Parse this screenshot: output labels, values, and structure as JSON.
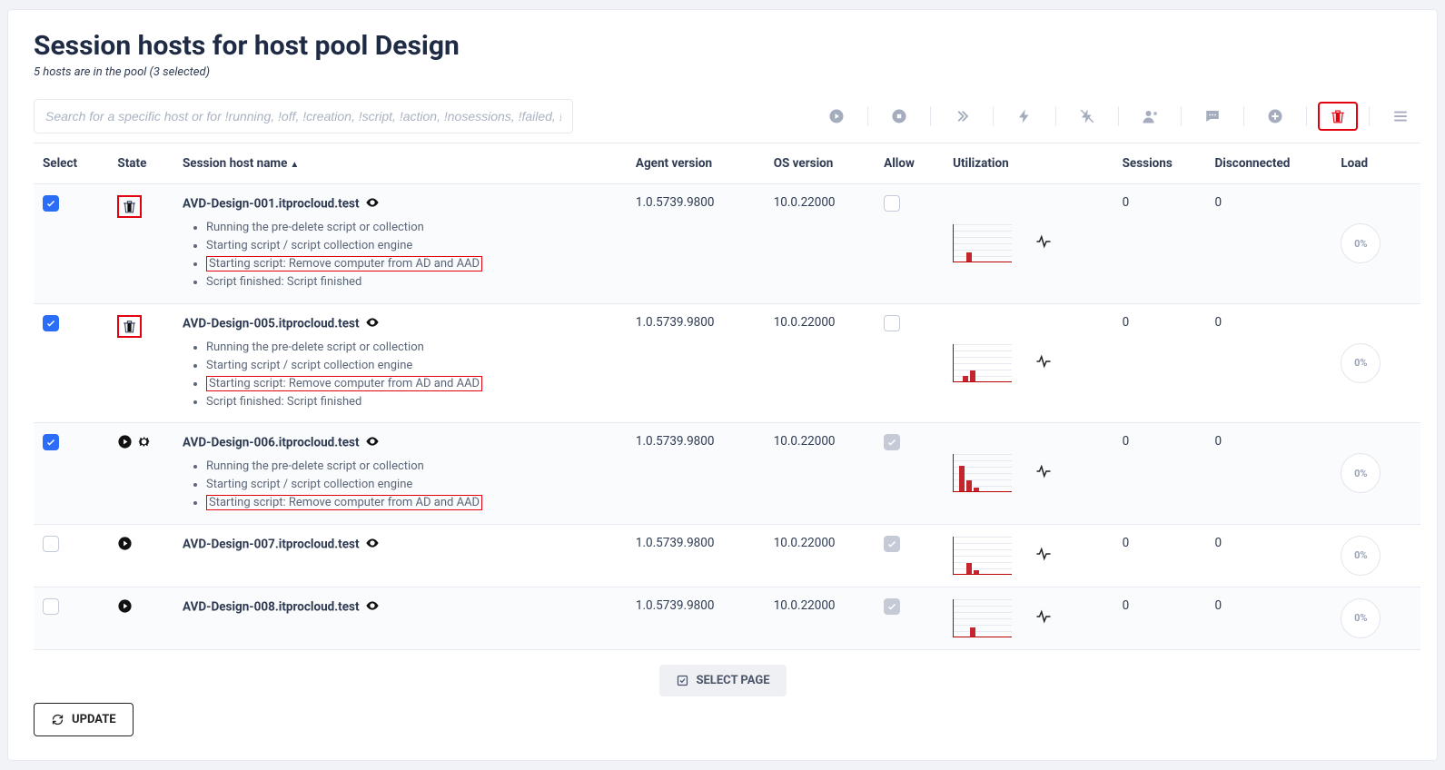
{
  "header": {
    "title": "Session hosts for host pool Design",
    "subtitle": "5 hosts are in the pool (3 selected)"
  },
  "search": {
    "placeholder": "Search for a specific host or for !running, !off, !creation, !script, !action, !nosessions, !failed, !drain"
  },
  "actions": [
    {
      "name": "start-icon"
    },
    {
      "name": "stop-icon"
    },
    {
      "name": "restart-icon"
    },
    {
      "name": "power-icon"
    },
    {
      "name": "drain-off-icon"
    },
    {
      "name": "user-icon"
    },
    {
      "name": "message-icon"
    },
    {
      "name": "add-icon"
    },
    {
      "name": "delete-icon",
      "highlight": true
    },
    {
      "name": "menu-icon"
    }
  ],
  "columns": {
    "select": "Select",
    "state": "State",
    "hostname": "Session host name",
    "agent": "Agent version",
    "os": "OS version",
    "allow": "Allow",
    "util": "Utilization",
    "sessions": "Sessions",
    "disconnected": "Disconnected",
    "load": "Load"
  },
  "rows": [
    {
      "selected": true,
      "state": {
        "kind": "delete-box"
      },
      "host": "AVD-Design-001.itprocloud.test",
      "notes": [
        {
          "text": "Running the pre-delete script or collection",
          "hl": false
        },
        {
          "text": "Starting script / script collection engine",
          "hl": false
        },
        {
          "text": "Starting script: Remove computer from AD and AAD",
          "hl": true
        },
        {
          "text": "Script finished: Script finished",
          "hl": false
        }
      ],
      "agent": "1.0.5739.9800",
      "os": "10.0.22000",
      "allow": false,
      "bars": [
        {
          "x": 14,
          "h": 10
        }
      ],
      "sessions": "0",
      "disconnected": "0",
      "load": "0%"
    },
    {
      "selected": true,
      "state": {
        "kind": "delete-box"
      },
      "host": "AVD-Design-005.itprocloud.test",
      "notes": [
        {
          "text": "Running the pre-delete script or collection",
          "hl": false
        },
        {
          "text": "Starting script / script collection engine",
          "hl": false
        },
        {
          "text": "Starting script: Remove computer from AD and AAD",
          "hl": true
        },
        {
          "text": "Script finished: Script finished",
          "hl": false
        }
      ],
      "agent": "1.0.5739.9800",
      "os": "10.0.22000",
      "allow": false,
      "bars": [
        {
          "x": 10,
          "h": 6
        },
        {
          "x": 18,
          "h": 12
        }
      ],
      "sessions": "0",
      "disconnected": "0",
      "load": "0%"
    },
    {
      "selected": true,
      "state": {
        "kind": "play-gear"
      },
      "host": "AVD-Design-006.itprocloud.test",
      "notes": [
        {
          "text": "Running the pre-delete script or collection",
          "hl": false
        },
        {
          "text": "Starting script / script collection engine",
          "hl": false
        },
        {
          "text": "Starting script: Remove computer from AD and AAD",
          "hl": true
        }
      ],
      "agent": "1.0.5739.9800",
      "os": "10.0.22000",
      "allow": "soft",
      "bars": [
        {
          "x": 6,
          "h": 28
        },
        {
          "x": 14,
          "h": 12
        },
        {
          "x": 22,
          "h": 4
        }
      ],
      "sessions": "0",
      "disconnected": "0",
      "load": "0%"
    },
    {
      "selected": false,
      "state": {
        "kind": "play"
      },
      "host": "AVD-Design-007.itprocloud.test",
      "notes": [],
      "agent": "1.0.5739.9800",
      "os": "10.0.22000",
      "allow": "soft",
      "bars": [
        {
          "x": 14,
          "h": 12
        },
        {
          "x": 22,
          "h": 4
        }
      ],
      "sessions": "0",
      "disconnected": "0",
      "load": "0%"
    },
    {
      "selected": false,
      "state": {
        "kind": "play"
      },
      "host": "AVD-Design-008.itprocloud.test",
      "notes": [],
      "agent": "1.0.5739.9800",
      "os": "10.0.22000",
      "allow": "soft",
      "bars": [
        {
          "x": 18,
          "h": 10
        }
      ],
      "sessions": "0",
      "disconnected": "0",
      "load": "0%"
    }
  ],
  "footer": {
    "selectpage": "SELECT PAGE",
    "update": "UPDATE"
  }
}
